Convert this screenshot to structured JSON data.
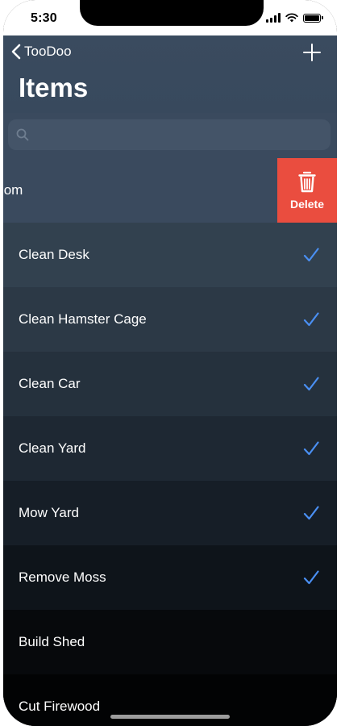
{
  "status_bar": {
    "time": "5:30"
  },
  "navbar": {
    "back_label": "TooDoo",
    "title": "Items",
    "add_icon": "plus-icon"
  },
  "search": {
    "placeholder": "",
    "value": ""
  },
  "swipe_action": {
    "label": "Delete",
    "icon": "trash-icon",
    "color": "#ea4d3f"
  },
  "colors": {
    "checkmark": "#4a8ff2"
  },
  "items": [
    {
      "label": "Room",
      "done": false,
      "bg": "#3a4a5e"
    },
    {
      "label": "Clean Desk",
      "done": true,
      "bg": "#32414f"
    },
    {
      "label": "Clean Hamster Cage",
      "done": true,
      "bg": "#2c3946"
    },
    {
      "label": "Clean Car",
      "done": true,
      "bg": "#25313d"
    },
    {
      "label": "Clean Yard",
      "done": true,
      "bg": "#1e2833"
    },
    {
      "label": "Mow Yard",
      "done": true,
      "bg": "#161e27"
    },
    {
      "label": "Remove Moss",
      "done": true,
      "bg": "#0e141a"
    },
    {
      "label": "Build Shed",
      "done": false,
      "bg": "#07090c"
    },
    {
      "label": "Cut Firewood",
      "done": false,
      "bg": "#020304"
    }
  ]
}
